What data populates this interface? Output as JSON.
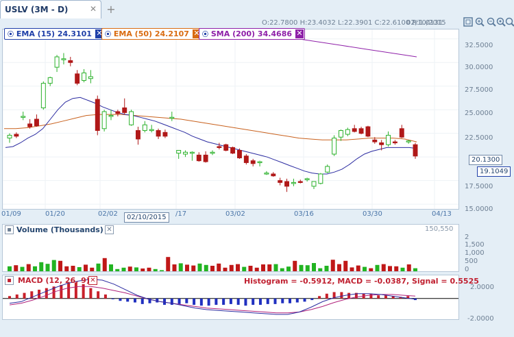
{
  "tab": {
    "title": "USLV (3M - D)",
    "close_icon": "✕",
    "add_icon": "+"
  },
  "ohlc_readout": "O:22.7800  H:23.4032  L:22.3901  C:22.6100  R:1.0131",
  "date_readout": "02/10/2015",
  "toolbar_icons": [
    "fit-screen-icon",
    "zoom-in-icon",
    "zoom-out-icon",
    "zoom-reset-icon",
    "magnify-icon"
  ],
  "indicators": [
    {
      "label": "EMA (15) 24.3101",
      "color": "#1f3fa8"
    },
    {
      "label": "EMA (50) 24.2107",
      "color": "#d96b10"
    },
    {
      "label": "SMA (200) 34.4686",
      "color": "#8e1fa8"
    }
  ],
  "price_axis": [
    "32.5000",
    "30.0000",
    "27.5000",
    "25.0000",
    "22.5000",
    "17.5000",
    "15.0000"
  ],
  "price_badges": {
    "last": "20.1300",
    "ema": "19.1049"
  },
  "date_axis": [
    "01/09",
    "01/20",
    "02/02",
    "/17",
    "03/02",
    "03/16",
    "03/30",
    "04/13"
  ],
  "cursor_date": "02/10/2015",
  "volume": {
    "title": "Volume (Thousands)",
    "readout": "150,550",
    "axis": [
      "2",
      "1,500",
      "1,000",
      "500",
      "0"
    ]
  },
  "macd": {
    "title": "MACD (12, 26, 9)",
    "readout": "Histogram = -0.5912, MACD = -0.0387, Signal = 0.5525",
    "axis": [
      "2.0000",
      "-2.0000"
    ]
  },
  "chart_data": {
    "type": "candlestick",
    "symbol": "USLV",
    "candles": [
      [
        22.0,
        22.5,
        21.5,
        22.3
      ],
      [
        22.4,
        22.6,
        22.0,
        22.2
      ],
      [
        24.2,
        24.8,
        23.9,
        24.3
      ],
      [
        23.5,
        24.0,
        23.0,
        23.2
      ],
      [
        24.0,
        24.5,
        23.2,
        23.3
      ],
      [
        25.2,
        28.0,
        25.0,
        27.8
      ],
      [
        27.8,
        28.5,
        27.5,
        28.4
      ],
      [
        29.5,
        30.8,
        29.0,
        30.6
      ],
      [
        30.3,
        31.0,
        29.8,
        30.4
      ],
      [
        30.2,
        30.6,
        29.6,
        30.0
      ],
      [
        28.8,
        29.2,
        27.6,
        27.8
      ],
      [
        28.1,
        29.3,
        27.9,
        28.9
      ],
      [
        28.3,
        29.2,
        27.8,
        28.5
      ],
      [
        26.1,
        26.5,
        22.3,
        22.8
      ],
      [
        23.0,
        25.0,
        22.7,
        24.8
      ],
      [
        24.4,
        25.0,
        23.9,
        24.4
      ],
      [
        24.8,
        25.0,
        24.3,
        24.6
      ],
      [
        25.2,
        26.2,
        24.5,
        24.7
      ],
      [
        23.4,
        25.0,
        23.3,
        24.8
      ],
      [
        22.8,
        23.2,
        21.3,
        21.9
      ],
      [
        22.8,
        23.8,
        22.6,
        23.4
      ],
      [
        22.8,
        23.4,
        22.6,
        22.9
      ],
      [
        22.8,
        23.0,
        21.9,
        22.2
      ],
      [
        22.6,
        22.9,
        22.0,
        22.2
      ],
      [
        24.1,
        24.8,
        23.8,
        24.2
      ],
      [
        20.4,
        20.6,
        19.8,
        20.7
      ],
      [
        20.3,
        20.7,
        20.0,
        20.5
      ],
      [
        20.4,
        20.6,
        19.6,
        20.5
      ],
      [
        20.2,
        20.5,
        19.5,
        19.6
      ],
      [
        20.2,
        20.6,
        19.4,
        19.5
      ],
      [
        20.5,
        20.7,
        20.2,
        20.5
      ],
      [
        21.1,
        21.5,
        20.8,
        21.0
      ],
      [
        21.3,
        21.4,
        20.6,
        20.7
      ],
      [
        21.0,
        21.1,
        20.3,
        20.4
      ],
      [
        20.7,
        20.9,
        19.8,
        19.9
      ],
      [
        20.1,
        20.3,
        19.2,
        19.4
      ],
      [
        19.6,
        19.8,
        19.0,
        19.3
      ],
      [
        19.4,
        19.6,
        19.0,
        19.5
      ],
      [
        18.3,
        18.5,
        18.1,
        18.3
      ],
      [
        18.2,
        18.4,
        17.9,
        18.0
      ],
      [
        17.5,
        17.8,
        17.0,
        17.3
      ],
      [
        17.4,
        17.7,
        16.3,
        16.9
      ],
      [
        17.2,
        17.7,
        16.9,
        17.3
      ],
      [
        17.4,
        17.6,
        17.2,
        17.3
      ],
      [
        17.6,
        17.8,
        17.4,
        17.7
      ],
      [
        16.9,
        17.2,
        16.6,
        17.4
      ],
      [
        17.2,
        18.3,
        17.1,
        18.2
      ],
      [
        18.4,
        19.2,
        18.3,
        19.0
      ],
      [
        20.3,
        22.3,
        20.1,
        22.0
      ],
      [
        22.1,
        22.9,
        21.7,
        22.8
      ],
      [
        22.4,
        23.1,
        22.2,
        22.9
      ],
      [
        23.0,
        23.4,
        22.6,
        22.7
      ],
      [
        23.0,
        23.2,
        22.4,
        22.5
      ],
      [
        23.2,
        23.3,
        22.1,
        22.2
      ],
      [
        21.8,
        22.1,
        21.4,
        21.6
      ],
      [
        21.5,
        21.8,
        20.7,
        21.3
      ],
      [
        21.3,
        22.7,
        21.1,
        22.3
      ],
      [
        21.6,
        21.8,
        21.3,
        21.5
      ],
      [
        23.0,
        23.4,
        22.0,
        22.1
      ],
      [
        21.6,
        21.8,
        21.4,
        21.7
      ],
      [
        21.3,
        21.5,
        19.8,
        20.1
      ]
    ],
    "ema15": [
      21.0,
      21.1,
      21.5,
      22.0,
      22.4,
      23.0,
      24.0,
      25.0,
      25.8,
      26.2,
      26.3,
      26.0,
      25.7,
      25.3,
      25.0,
      24.7,
      24.5,
      24.4,
      24.2,
      24.0,
      23.8,
      23.5,
      23.2,
      22.9,
      22.6,
      22.2,
      21.9,
      21.6,
      21.4,
      21.2,
      21.0,
      20.8,
      20.6,
      20.4,
      20.2,
      20.0,
      19.7,
      19.4,
      19.1,
      18.8,
      18.5,
      18.3,
      18.2,
      18.2,
      18.4,
      18.7,
      19.2,
      19.8,
      20.3,
      20.6,
      20.8,
      21.0,
      21.0,
      21.0,
      21.0,
      20.9
    ],
    "ema50": [
      23.0,
      23.0,
      23.1,
      23.3,
      23.5,
      23.8,
      24.1,
      24.4,
      24.5,
      24.5,
      24.5,
      24.4,
      24.3,
      24.2,
      24.1,
      24.0,
      23.8,
      23.6,
      23.4,
      23.2,
      23.0,
      22.8,
      22.6,
      22.4,
      22.2,
      22.0,
      21.9,
      21.8,
      21.8,
      21.8,
      21.9,
      22.0,
      22.0,
      22.0,
      21.9,
      21.6
    ],
    "sma200": [
      33.0,
      32.6,
      32.2,
      31.8,
      31.4,
      31.0,
      30.6
    ],
    "volume": [
      180,
      220,
      160,
      260,
      180,
      330,
      270,
      410,
      380,
      180,
      200,
      150,
      240,
      130,
      280,
      480,
      250,
      80,
      130,
      170,
      140,
      100,
      130,
      80,
      40,
      520,
      250,
      290,
      240,
      210,
      280,
      230,
      200,
      280,
      130,
      230,
      260,
      160,
      200,
      130,
      250,
      250,
      260,
      110,
      170,
      380,
      230,
      220,
      300,
      110,
      200,
      420,
      260,
      380,
      140,
      210,
      160,
      110,
      230,
      260,
      190,
      180,
      130,
      250,
      110
    ],
    "macd_hist": [
      0.3,
      0.5,
      0.7,
      0.9,
      1.1,
      1.3,
      1.5,
      1.7,
      1.9,
      2.0,
      1.8,
      1.3,
      0.9,
      0.5,
      -0.1,
      -0.3,
      -0.4,
      -0.5,
      -0.7,
      -0.6,
      -0.5,
      -0.8,
      -0.8,
      -0.7,
      -0.6,
      -0.8,
      -0.9,
      -0.9,
      -0.8,
      -0.8,
      -0.7,
      -0.8,
      -0.9,
      -0.8,
      -0.8,
      -0.7,
      -0.7,
      -0.6,
      -0.6,
      -0.5,
      -0.4,
      -0.2,
      0.3,
      0.6,
      0.8,
      0.8,
      0.7,
      0.7,
      0.6,
      0.6,
      0.4,
      0.4,
      0.3,
      0.2,
      0.3,
      -0.2
    ],
    "macd_line": [
      -0.6,
      -0.4,
      0.2,
      0.8,
      1.4,
      1.9,
      2.2,
      2.4,
      2.3,
      1.8,
      1.1,
      0.4,
      -0.1,
      -0.4,
      -0.6,
      -0.9,
      -1.2,
      -1.4,
      -1.5,
      -1.6,
      -1.7,
      -1.8,
      -1.9,
      -2.0,
      -2.0,
      -1.7,
      -1.1,
      -0.4,
      0.1,
      0.4,
      0.6,
      0.6,
      0.5,
      0.3,
      0.1,
      -0.1
    ],
    "macd_signal": [
      -0.8,
      -0.6,
      -0.2,
      0.3,
      0.9,
      1.3,
      1.5,
      1.5,
      1.3,
      1.0,
      0.7,
      0.3,
      -0.1,
      -0.4,
      -0.6,
      -0.8,
      -1.0,
      -1.2,
      -1.3,
      -1.4,
      -1.5,
      -1.6,
      -1.7,
      -1.8,
      -1.8,
      -1.7,
      -1.4,
      -1.0,
      -0.5,
      -0.1,
      0.2,
      0.4,
      0.5,
      0.5,
      0.4,
      0.3
    ],
    "price_ylim": [
      14.5,
      33.5
    ],
    "macd_ylim": [
      -2.6,
      2.9
    ],
    "colors": {
      "up": "#2ab12a",
      "down": "#b01818",
      "ema15": "#2a2aa0",
      "ema50": "#c8601c",
      "sma200": "#8e1fa8",
      "macd": "#2a2aa0",
      "signal": "#b0207a",
      "hist_pos": "#c8202a",
      "hist_neg": "#2030c0"
    }
  }
}
